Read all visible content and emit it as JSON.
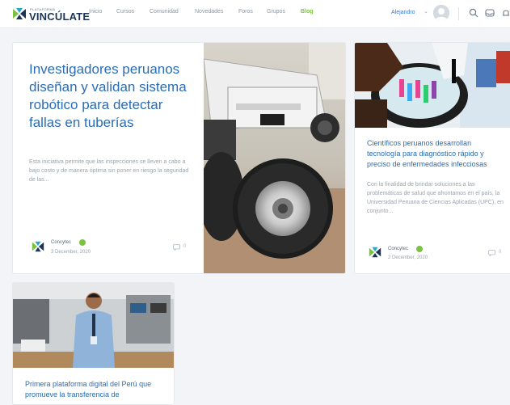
{
  "header": {
    "logo_small": "PLATAFORMA",
    "logo_brand": "VINCÚLATE",
    "nav": [
      "Inicio",
      "Cursos",
      "Comunidad",
      "Novedades",
      "Foros",
      "Grupos",
      "Blog"
    ],
    "active_nav": "Blog",
    "user_name": "Alejandro",
    "icons": [
      "search-icon",
      "inbox-icon",
      "notifications-icon"
    ]
  },
  "posts": [
    {
      "title": "Investigadores peruanos diseñan y validan sistema robótico para detectar fallas en tuberías",
      "excerpt": "Esta iniciativa permite que las inspecciones se lleven a cabo a bajo costo y de manera óptima sin poner en riesgo la seguridad de las...",
      "author": "Concytec",
      "date": "3 December, 2020",
      "comments": "0",
      "image": "robot-wheels-photo"
    },
    {
      "title": "Científicos peruanos desarrollan tecnología para diagnóstico rápido y preciso de enfermedades infecciosas",
      "excerpt": "Con la finalidad de brindar soluciones a las problemáticas de salud que afrontamos en el país, la Universidad Peruana de Ciencias Aplicadas (UPC), en conjunto...",
      "author": "Concytec",
      "date": "2 December, 2020",
      "comments": "0",
      "image": "lab-samples-photo"
    },
    {
      "title": "Primera plataforma digital del Perú que promueve la transferencia de",
      "image": "lab-researcher-photo"
    }
  ],
  "colors": {
    "accent_green": "#7cc242",
    "title_blue": "#2a6db5",
    "brand_navy": "#1c3557"
  }
}
